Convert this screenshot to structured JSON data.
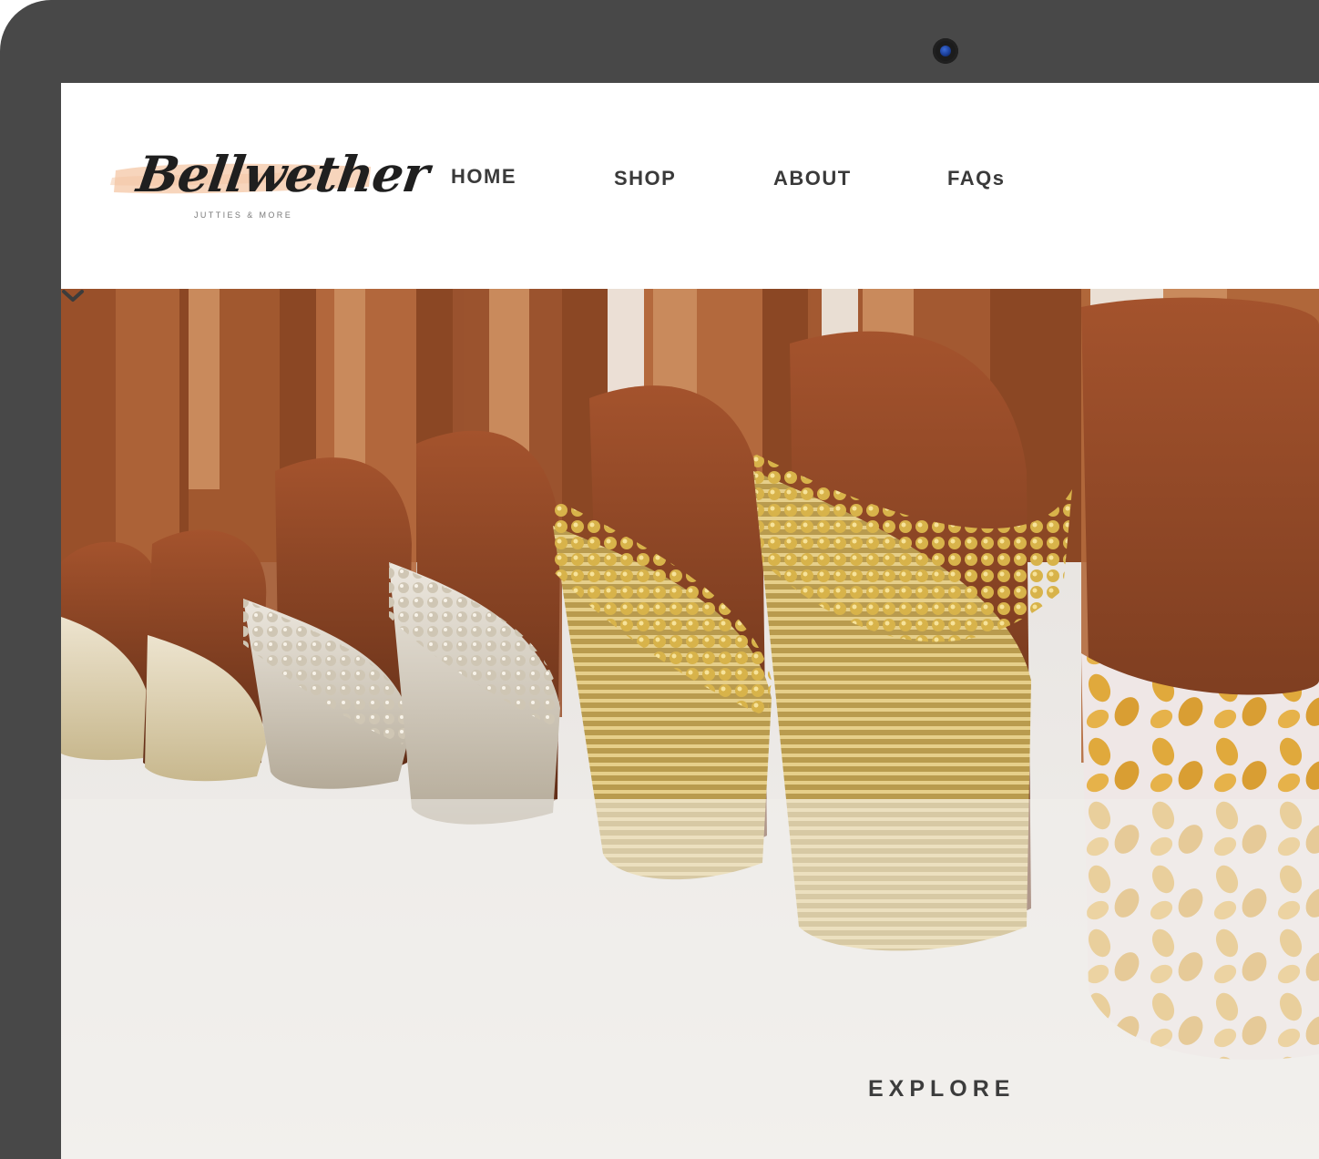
{
  "brand": {
    "name": "Bellwether",
    "tagline": "JUTTIES & MORE",
    "swash_color": "#f7d3b8"
  },
  "nav": {
    "items": [
      {
        "label": "HOME"
      },
      {
        "label": "SHOP"
      },
      {
        "label": "ABOUT"
      },
      {
        "label": "FAQs"
      }
    ]
  },
  "hero": {
    "image_subject": "embroidered jutti shoes",
    "cta_label": "EXPLORE",
    "cta_icon": "chevron-down-icon"
  },
  "device": {
    "bezel_color": "#484848",
    "camera_icon": "webcam-icon"
  }
}
